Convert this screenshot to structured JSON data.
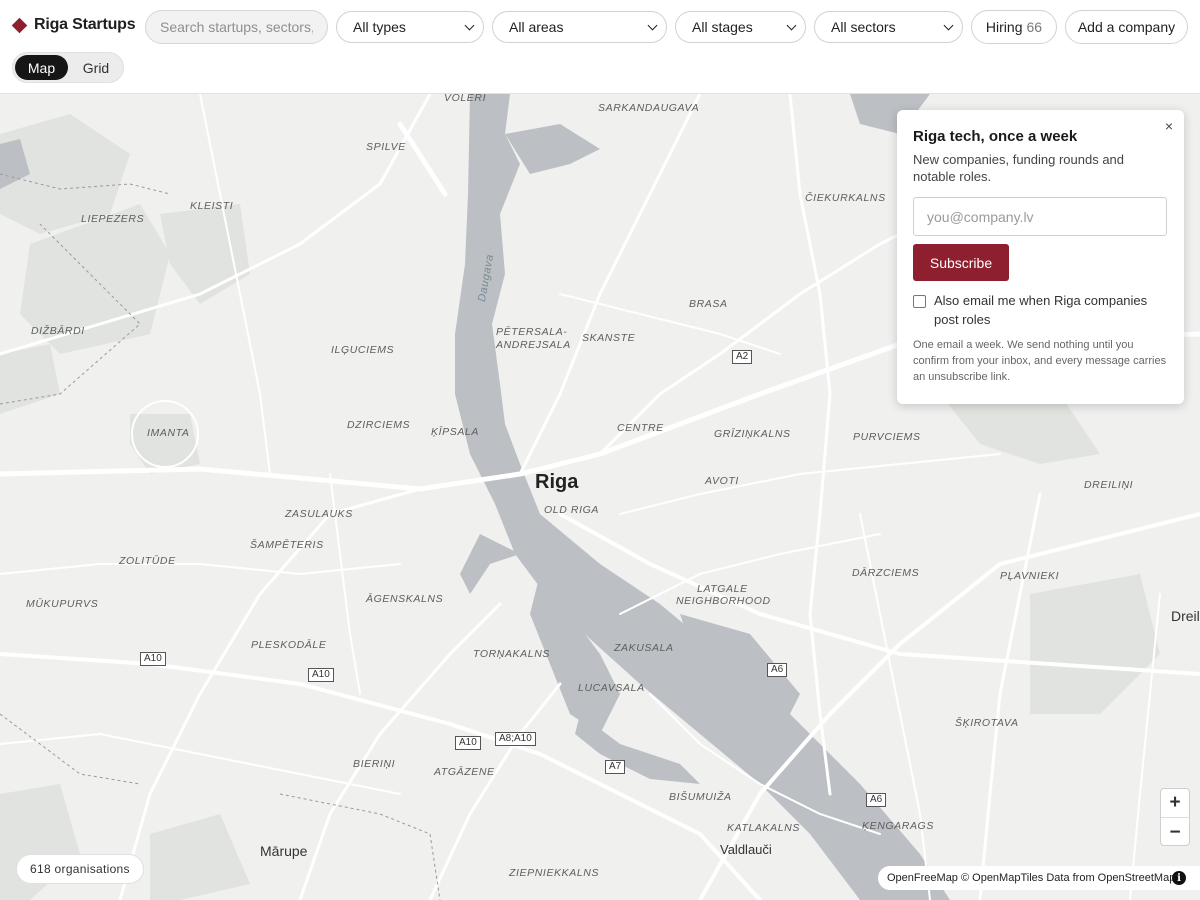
{
  "brand": {
    "name": "Riga Startups"
  },
  "search": {
    "placeholder": "Search startups, sectors, people"
  },
  "filters": [
    {
      "label": "All types"
    },
    {
      "label": "All areas"
    },
    {
      "label": "All stages"
    },
    {
      "label": "All sectors"
    }
  ],
  "hiring": {
    "label": "Hiring",
    "count": "66"
  },
  "add_company": {
    "label": "Add a company"
  },
  "view_toggle": {
    "map": "Map",
    "grid": "Grid",
    "active": "Map"
  },
  "map": {
    "labels": {
      "voleri": "VOLERI",
      "sarkandaugava": "SARKANDAUGAVA",
      "spilve": "SPILVE",
      "kleisti": "KLEISTI",
      "liepezers": "LIEPEZERS",
      "cieikurkalns": "ČIEKURKALNS",
      "dizbardi": "DIŽBĀRDI",
      "brasa": "BRASA",
      "petersala": "PĒTERSALA-",
      "andrejsala": "ANDREJSALA",
      "skanste": "SKANSTE",
      "ilguciems": "ILĢUCIEMS",
      "dzirciems": "DZIRCIEMS",
      "kipsala": "ĶĪPSALA",
      "centre": "CENTRE",
      "grizinkalns": "GRĪZIŅKALNS",
      "purvciems": "PURVCIEMS",
      "imanta": "IMANTA",
      "riga": "Riga",
      "old_riga": "OLD RIGA",
      "avoti": "AVOTI",
      "dreilini": "DREILIŅI",
      "zasulauks": "ZASULAUKS",
      "sampeteris": "ŠAMPĒTERIS",
      "zolitude": "ZOLITŪDE",
      "darzciems": "DĀRZCIEMS",
      "plavnieki": "PĻAVNIEKI",
      "latgale1": "LATGALE",
      "latgale2": "NEIGHBORHOOD",
      "mukupurvs": "MŪKUPURVS",
      "agenskalns": "ĀGENSKALNS",
      "dreili_town": "Dreili",
      "pleskodale": "PLESKODĀLE",
      "zakusala": "ZAKUSALA",
      "tornakalns": "TORŅAKALNS",
      "lucavsala": "LUCAVSALA",
      "skirotava": "ŠĶIROTAVA",
      "bierini": "BIERIŅI",
      "atgazene": "ATGĀZENE",
      "bisumuiza": "BIŠUMUIŽA",
      "katlakalns": "KATLAKALNS",
      "kengarags": "ĶENGARAGS",
      "marupe": "Mārupe",
      "valdlauci": "Valdlauči",
      "zipniekkalns": "ZIEPNIEKKALNS",
      "daugava": "Daugava"
    },
    "shields": {
      "a2": "A2",
      "a10_1": "A10",
      "a10_2": "A10",
      "a10_3": "A10",
      "a8a10": "A8;A10",
      "a7": "A7",
      "a6_1": "A6",
      "a6_2": "A6"
    },
    "colors": {
      "land": "#f0f0ef",
      "water": "#bcc0c4",
      "park": "#e0e2e0",
      "road": "#ffffff",
      "accent": "#8e1f2e"
    }
  },
  "newsletter": {
    "title": "Riga tech, once a week",
    "description": "New companies, funding rounds and notable roles.",
    "email_placeholder": "you@company.lv",
    "subscribe_label": "Subscribe",
    "checkbox_label": "Also email me when Riga companies post roles",
    "fine_print": "One email a week. We send nothing until you confirm from your inbox, and every message carries an unsubscribe link.",
    "close_glyph": "×"
  },
  "zoom": {
    "in": "+",
    "out": "−"
  },
  "org_count": "618 organisations",
  "attribution": "OpenFreeMap © OpenMapTiles Data from OpenStreetMap",
  "attribution_info": "i"
}
